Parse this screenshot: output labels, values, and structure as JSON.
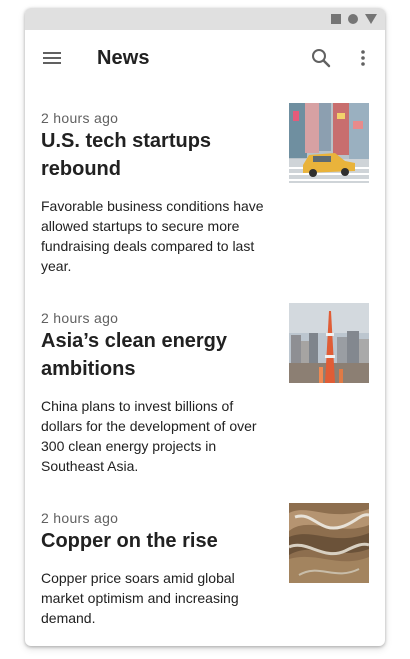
{
  "status_bar": {
    "icons": [
      "square-icon",
      "circle-icon",
      "triangle-icon"
    ]
  },
  "app_bar": {
    "title": "News",
    "menu_icon": "menu-icon",
    "search_icon": "search-icon",
    "more_icon": "more-vert-icon"
  },
  "articles": [
    {
      "time": "2 hours ago",
      "title": "U.S. tech startups rebound",
      "body": "Favorable business conditions have allowed startups to secure more fundraising deals compared to last year."
    },
    {
      "time": "2 hours ago",
      "title": "Asia’s clean energy ambitions",
      "body": "China plans to invest billions of dollars for the development of over 300 clean energy projects in Southeast Asia."
    },
    {
      "time": "2 hours ago",
      "title": "Copper on the rise",
      "body": "Copper price soars amid global market optimism and increasing demand."
    }
  ],
  "colors": {
    "status_bar": "#e0e0e0",
    "status_icons": "#757575",
    "text_primary": "#212121",
    "text_secondary": "#616161"
  }
}
